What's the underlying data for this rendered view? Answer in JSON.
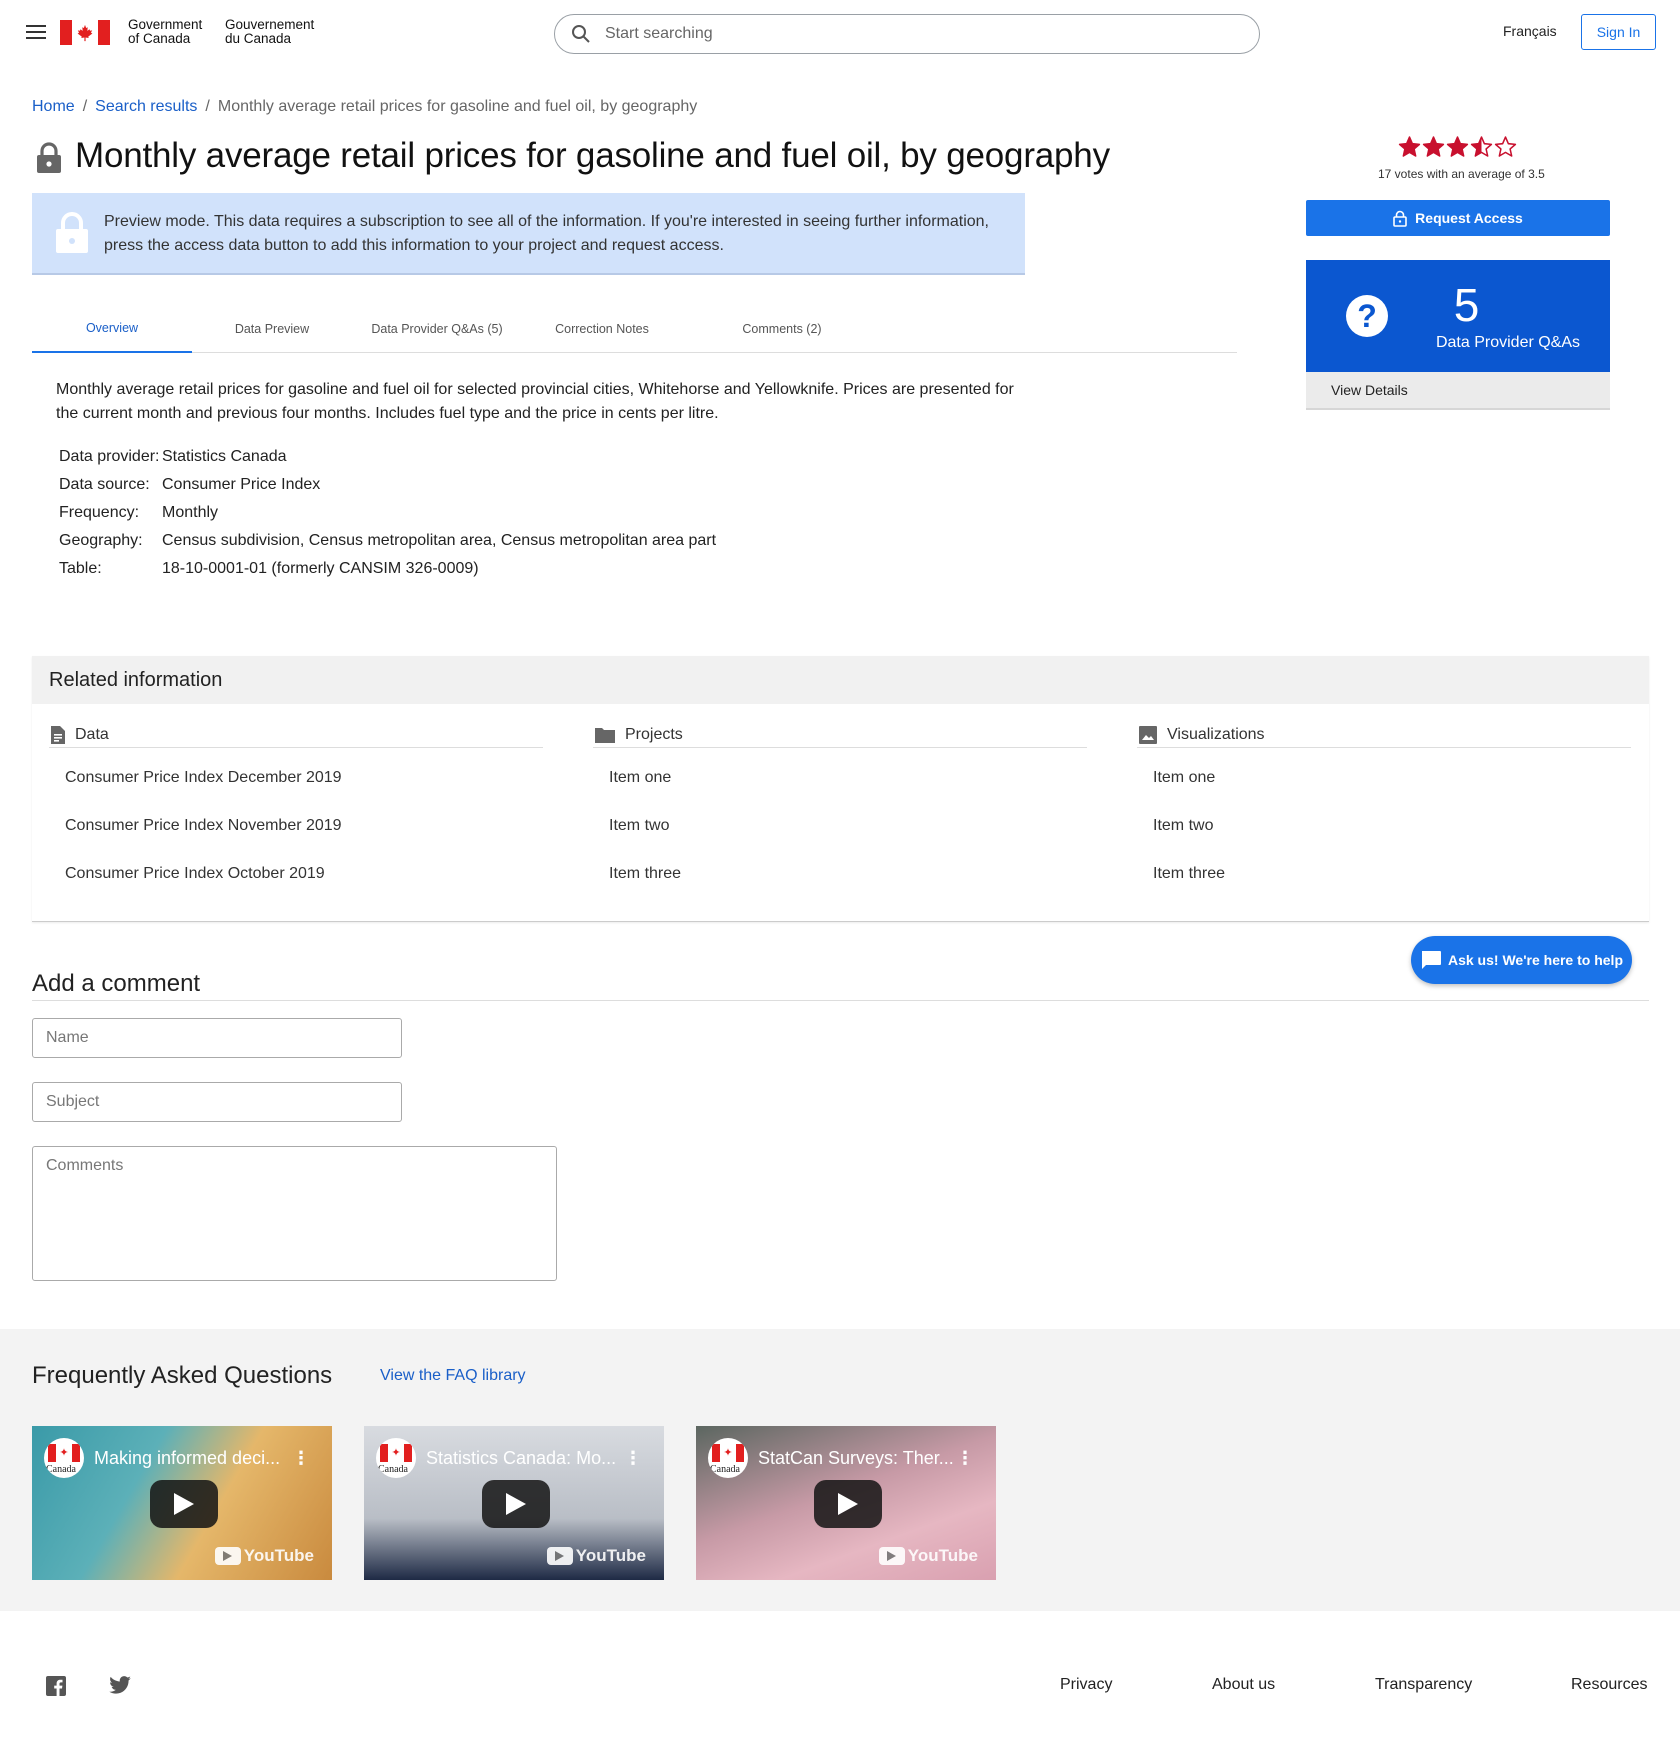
{
  "header": {
    "gov_en_line1": "Government",
    "gov_en_line2": "of Canada",
    "gov_fr_line1": "Gouvernement",
    "gov_fr_line2": "du Canada",
    "search_placeholder": "Start searching",
    "language": "Français",
    "sign_in": "Sign In"
  },
  "breadcrumb": {
    "home": "Home",
    "search_results": "Search results",
    "current": "Monthly average retail prices for gasoline and fuel oil, by geography",
    "separator": "/"
  },
  "page_title": "Monthly average retail prices for gasoline and fuel oil, by geography",
  "preview_banner": "Preview mode. This data requires a subscription to see all of the information. If you're interested in seeing further information, press the access data button to add this information to your project and request access.",
  "tabs": [
    {
      "label": "Overview",
      "active": true
    },
    {
      "label": "Data Preview",
      "active": false
    },
    {
      "label": "Data Provider Q&As (5)",
      "active": false
    },
    {
      "label": "Correction Notes",
      "active": false
    },
    {
      "label": "Comments (2)",
      "active": false
    }
  ],
  "description": "Monthly average retail prices for gasoline and fuel oil for selected provincial cities, Whitehorse and Yellowknife. Prices are presented for the current month and previous four months. Includes fuel type and the price in cents per litre.",
  "metadata": [
    {
      "key": "Data provider:",
      "value": "Statistics Canada"
    },
    {
      "key": "Data source:",
      "value": "Consumer Price Index"
    },
    {
      "key": "Frequency:",
      "value": "Monthly"
    },
    {
      "key": "Geography:",
      "value": "Census subdivision, Census metropolitan area, Census metropolitan area part"
    },
    {
      "key": "Table:",
      "value": "18-10-0001-01 (formerly CANSIM 326-0009)"
    }
  ],
  "rating": {
    "value": 3.5,
    "max": 5,
    "votes_text": "17 votes with an average of 3.5",
    "star_color": "#c8102e"
  },
  "request_access": "Request Access",
  "qa_card": {
    "count": "5",
    "label": "Data Provider Q&As",
    "view_details": "View Details"
  },
  "related": {
    "title": "Related information",
    "columns": [
      {
        "heading": "Data",
        "icon": "document-icon",
        "items": [
          "Consumer Price Index December 2019",
          "Consumer Price Index November 2019",
          "Consumer Price Index October 2019"
        ]
      },
      {
        "heading": "Projects",
        "icon": "folder-icon",
        "items": [
          "Item one",
          "Item two",
          "Item three"
        ]
      },
      {
        "heading": "Visualizations",
        "icon": "image-icon",
        "items": [
          "Item one",
          "Item two",
          "Item three"
        ]
      }
    ]
  },
  "comment_form": {
    "title": "Add a comment",
    "name_placeholder": "Name",
    "subject_placeholder": "Subject",
    "comments_placeholder": "Comments"
  },
  "ask_us": "Ask us! We're here to help",
  "faq": {
    "title": "Frequently Asked Questions",
    "link": "View the FAQ library",
    "videos": [
      {
        "title": "Making informed deci...",
        "channel": "Canada",
        "platform": "YouTube"
      },
      {
        "title": "Statistics Canada: Mo...",
        "channel": "Canada",
        "platform": "YouTube"
      },
      {
        "title": "StatCan Surveys: Ther...",
        "channel": "Canada",
        "platform": "YouTube"
      }
    ]
  },
  "footer": {
    "links": [
      "Privacy",
      "About us",
      "Transparency",
      "Resources"
    ],
    "social": [
      "facebook-icon",
      "twitter-icon"
    ]
  },
  "colors": {
    "accent": "#1a73e8",
    "qa_card": "#0b57d0",
    "preview_bg": "#d1e2fb",
    "canada_red": "#e21f1f"
  }
}
